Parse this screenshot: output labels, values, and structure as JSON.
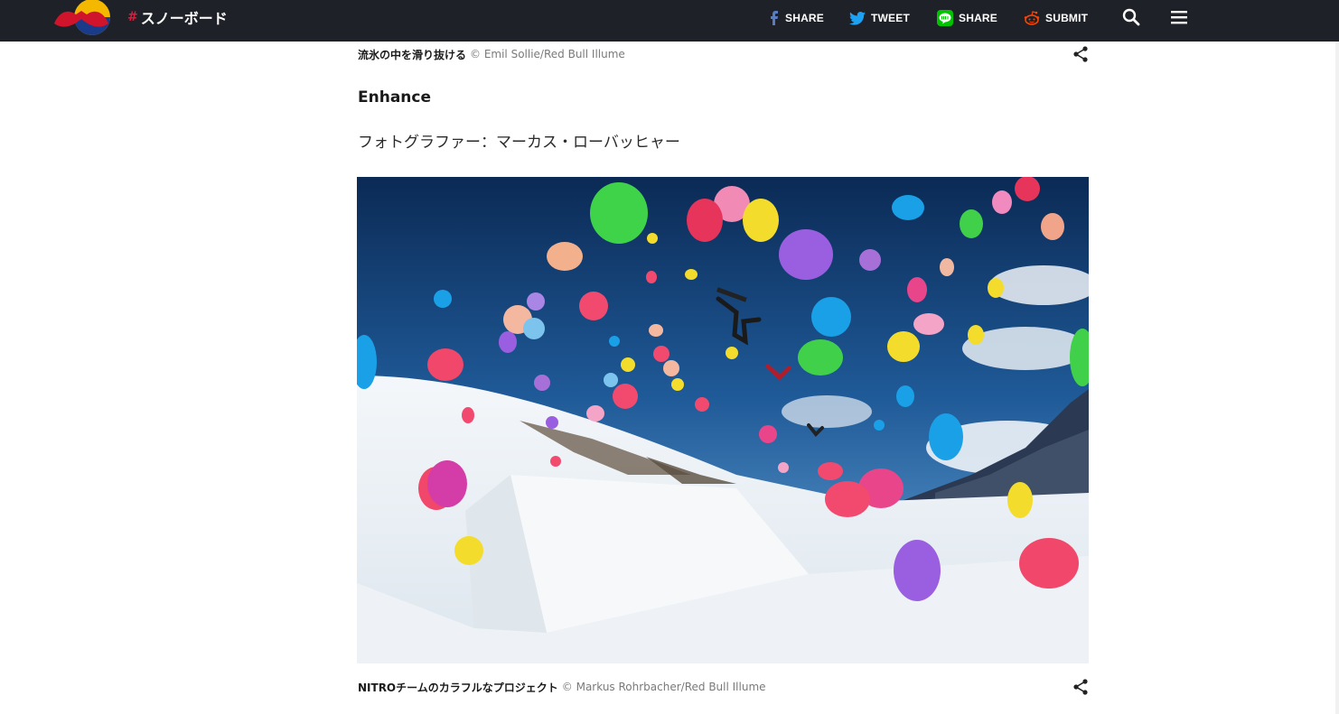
{
  "header": {
    "channel_hash": "#",
    "channel_label": "スノーボード",
    "share_facebook": "SHARE",
    "share_twitter": "TWEET",
    "share_line": "SHARE",
    "share_reddit": "SUBMIT",
    "icons": [
      "red-bull-logo",
      "facebook-icon",
      "twitter-icon",
      "line-icon",
      "reddit-icon",
      "search-icon",
      "menu-icon"
    ]
  },
  "article": {
    "top_caption": {
      "text": "流氷の中を滑り抜ける",
      "credit": "© Emil Sollie/Red Bull Illume"
    },
    "section_title": "Enhance",
    "photographer": "フォトグラファー：マーカス・ローバッヒャー",
    "photo_caption": {
      "text": "NITROチームのカラフルなプロジェクト",
      "credit": "© Markus Rohrbacher/Red Bull Illume"
    }
  },
  "colors": {
    "topbar": "#1e2128",
    "accent_red": "#e3183c",
    "facebook": "#3b5998",
    "twitter": "#1da1f2",
    "line": "#00c300",
    "reddit": "#ff4500"
  }
}
